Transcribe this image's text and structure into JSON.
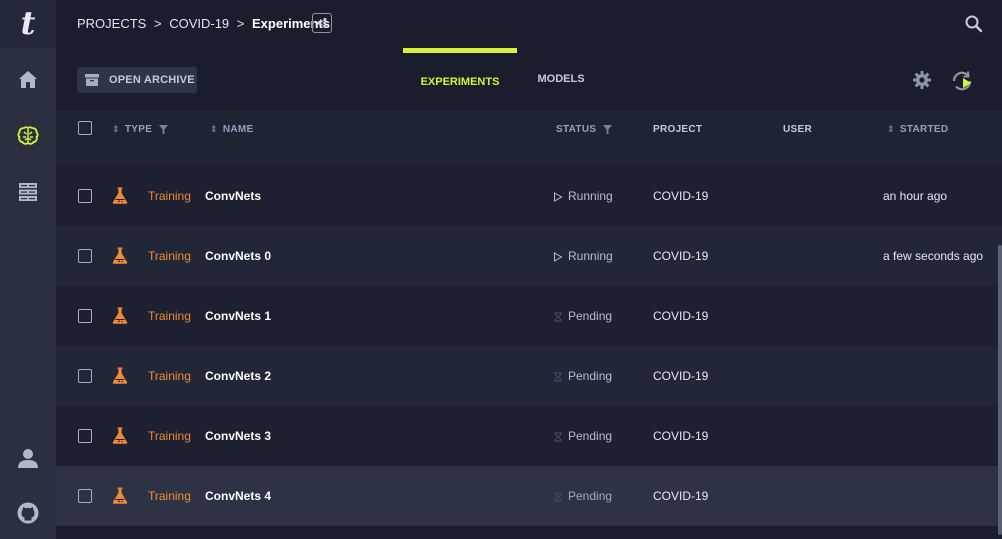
{
  "breadcrumb": {
    "projects": "PROJECTS",
    "sep1": ">",
    "project": "COVID-19",
    "sep2": ">",
    "current": "Experiments"
  },
  "toolbar": {
    "archive_label": "OPEN ARCHIVE"
  },
  "tabs": [
    {
      "label": "EXPERIMENTS",
      "active": true
    },
    {
      "label": "MODELS",
      "active": false
    }
  ],
  "columns": {
    "type": "TYPE",
    "name": "NAME",
    "status": "STATUS",
    "project": "PROJECT",
    "user": "USER",
    "started": "STARTED"
  },
  "rows": [
    {
      "type": "Training",
      "name": "ConvNets",
      "status": "Running",
      "project": "COVID-19",
      "user": "",
      "started": "an hour ago"
    },
    {
      "type": "Training",
      "name": "ConvNets 0",
      "status": "Running",
      "project": "COVID-19",
      "user": "",
      "started": "a few seconds ago"
    },
    {
      "type": "Training",
      "name": "ConvNets 1",
      "status": "Pending",
      "project": "COVID-19",
      "user": "",
      "started": ""
    },
    {
      "type": "Training",
      "name": "ConvNets 2",
      "status": "Pending",
      "project": "COVID-19",
      "user": "",
      "started": ""
    },
    {
      "type": "Training",
      "name": "ConvNets 3",
      "status": "Pending",
      "project": "COVID-19",
      "user": "",
      "started": ""
    },
    {
      "type": "Training",
      "name": "ConvNets 4",
      "status": "Pending",
      "project": "COVID-19",
      "user": "",
      "started": ""
    }
  ],
  "colors": {
    "accent": "#d8f23a",
    "type_text": "#f08a36",
    "sidebar_bg": "#2b3040",
    "page_bg": "#1a1e2c"
  },
  "icons": {
    "logo": "t",
    "sidebar": [
      "home-icon",
      "brain-icon",
      "server-icon",
      "user-icon",
      "github-icon"
    ],
    "header": [
      "share-icon",
      "search-icon",
      "archive-icon",
      "gear-icon",
      "refresh-icon"
    ],
    "row": [
      "flask-icon",
      "running-icon",
      "pending-icon"
    ]
  }
}
